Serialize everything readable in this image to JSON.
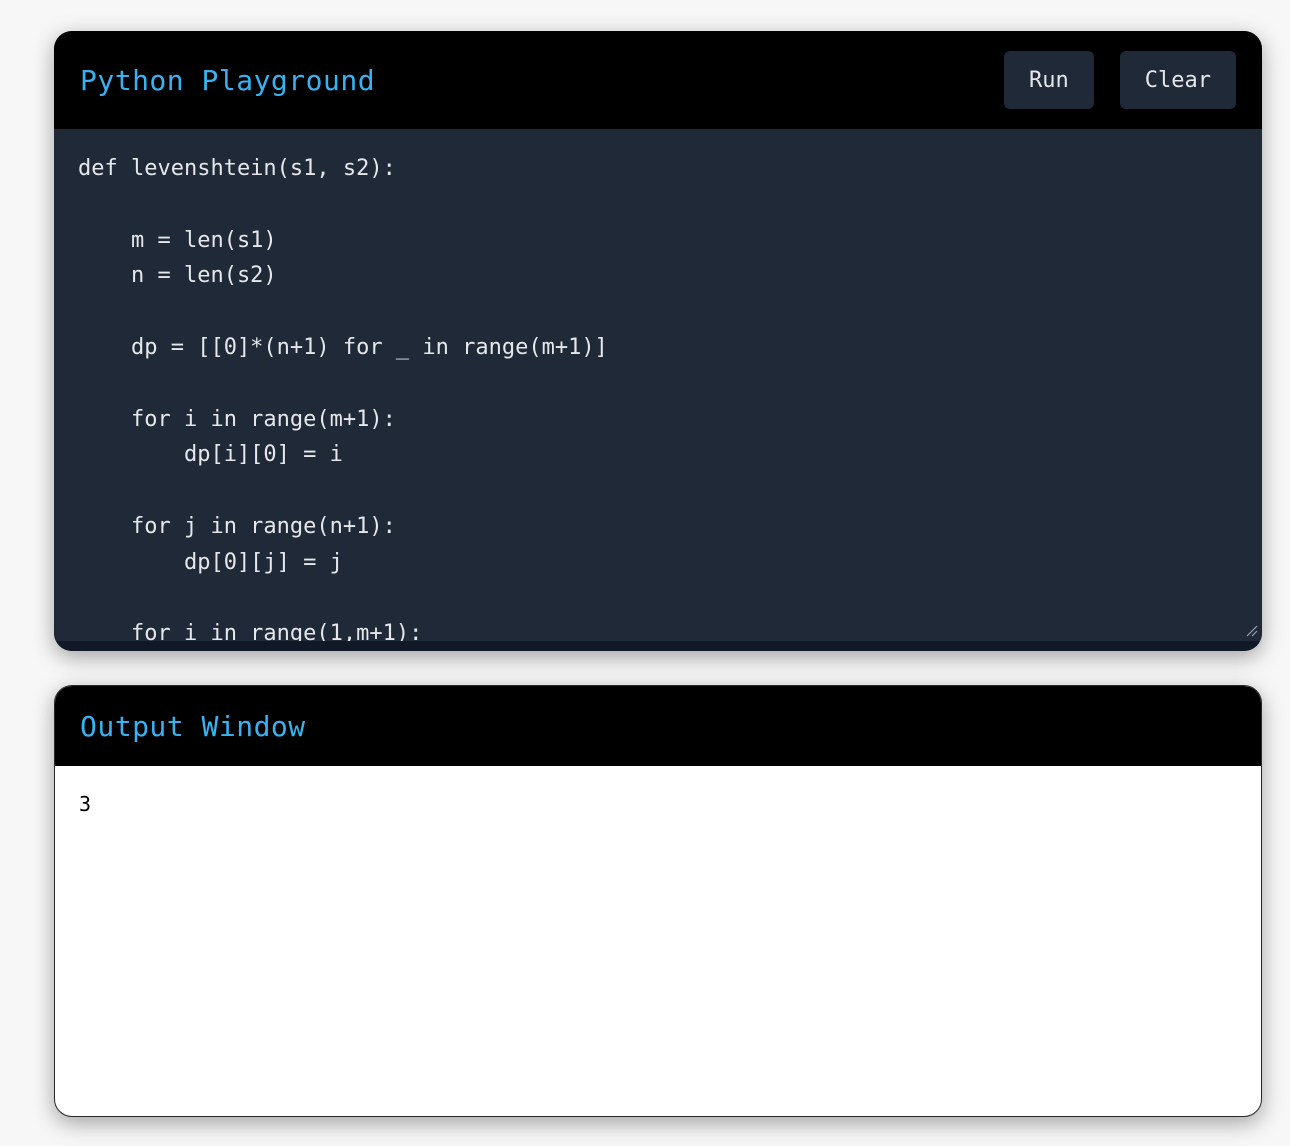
{
  "editor": {
    "title": "Python Playground",
    "run_label": "Run",
    "clear_label": "Clear",
    "code": "def levenshtein(s1, s2):\n\n    m = len(s1)\n    n = len(s2)\n\n    dp = [[0]*(n+1) for _ in range(m+1)]\n\n    for i in range(m+1):\n        dp[i][0] = i\n\n    for j in range(n+1):\n        dp[0][j] = j\n\n    for i in range(1,m+1):"
  },
  "output": {
    "title": "Output Window",
    "text": "3"
  },
  "icons": {
    "resize": "resize-grip-icon"
  },
  "colors": {
    "accent": "#38b2f0",
    "header_bg": "#000000",
    "editor_bg": "#1f2937",
    "button_bg": "#1f2937"
  }
}
